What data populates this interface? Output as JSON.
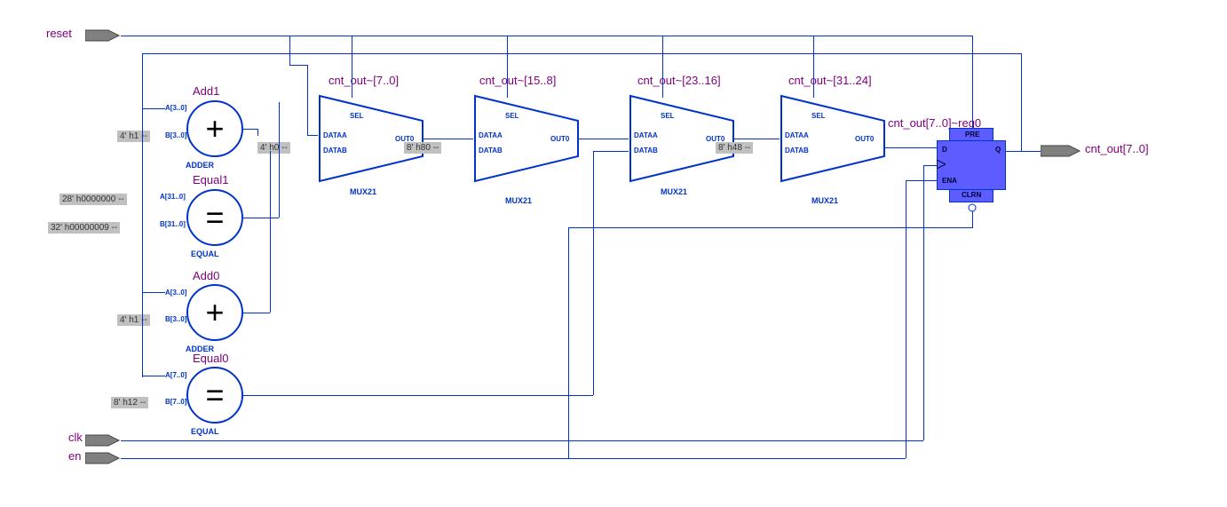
{
  "inputs": {
    "reset": "reset",
    "clk": "clk",
    "en": "en"
  },
  "outputs": {
    "cnt_out": "cnt_out[7..0]"
  },
  "blocks": {
    "add1": {
      "title": "Add1",
      "type": "ADDER",
      "sym": "+",
      "portA": "A[3..0]",
      "portB": "B[3..0]",
      "constB": "4' h1 --"
    },
    "equal1": {
      "title": "Equal1",
      "type": "EQUAL",
      "sym": "=",
      "portA": "A[31..0]",
      "portB": "B[31..0]",
      "constA": "28' h0000000 --",
      "constB": "32' h00000009 --"
    },
    "add0": {
      "title": "Add0",
      "type": "ADDER",
      "sym": "+",
      "portA": "A[3..0]",
      "portB": "B[3..0]",
      "constB": "4' h1 --"
    },
    "equal0": {
      "title": "Equal0",
      "type": "EQUAL",
      "sym": "=",
      "portA": "A[7..0]",
      "portB": "B[7..0]",
      "constB": "8' h12 --"
    },
    "mux1": {
      "title": "cnt_out~[7..0]",
      "type": "MUX21",
      "constB": "4' h0 --"
    },
    "mux2": {
      "title": "cnt_out~[15..8]",
      "type": "MUX21",
      "constB": "8' h80 --"
    },
    "mux3": {
      "title": "cnt_out~[23..16]",
      "type": "MUX21"
    },
    "mux4": {
      "title": "cnt_out~[31..24]",
      "type": "MUX21",
      "constB": "8' h48 --"
    },
    "reg": {
      "title": "cnt_out[7..0]~reg0",
      "pre": "PRE",
      "d": "D",
      "q": "Q",
      "ena": "ENA",
      "clrn": "CLRN"
    }
  },
  "mux_ports": {
    "sel": "SEL",
    "dataa": "DATAA",
    "datab": "DATAB",
    "out": "OUT0"
  }
}
